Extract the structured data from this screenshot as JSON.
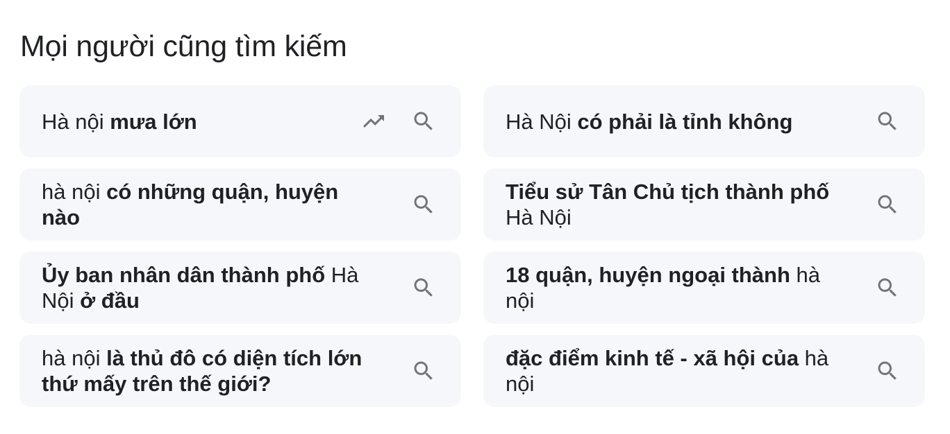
{
  "heading": "Mọi người cũng tìm kiếm",
  "items": [
    {
      "segments": [
        {
          "text": "Hà nội ",
          "bold": false
        },
        {
          "text": "mưa lớn",
          "bold": true
        }
      ],
      "icons": [
        "trending-icon",
        "search-icon"
      ]
    },
    {
      "segments": [
        {
          "text": "Hà Nội ",
          "bold": false
        },
        {
          "text": "có phải là tỉnh không",
          "bold": true
        }
      ],
      "icons": [
        "search-icon"
      ]
    },
    {
      "segments": [
        {
          "text": "hà nội ",
          "bold": false
        },
        {
          "text": "có những quận, huyện nào",
          "bold": true
        }
      ],
      "icons": [
        "search-icon"
      ]
    },
    {
      "segments": [
        {
          "text": "Tiểu sử Tân Chủ tịch thành phố",
          "bold": true
        },
        {
          "text": " Hà Nội",
          "bold": false
        }
      ],
      "icons": [
        "search-icon"
      ]
    },
    {
      "segments": [
        {
          "text": "Ủy ban nhân dân thành phố",
          "bold": true
        },
        {
          "text": " Hà Nội ",
          "bold": false
        },
        {
          "text": "ở đầu",
          "bold": true
        }
      ],
      "icons": [
        "search-icon"
      ]
    },
    {
      "segments": [
        {
          "text": "18 quận, huyện ngoại thành",
          "bold": true
        },
        {
          "text": " hà nội",
          "bold": false
        }
      ],
      "icons": [
        "search-icon"
      ]
    },
    {
      "segments": [
        {
          "text": "hà nội ",
          "bold": false
        },
        {
          "text": "là thủ đô có diện tích lớn thứ mấy trên thế giới?",
          "bold": true
        }
      ],
      "icons": [
        "search-icon"
      ]
    },
    {
      "segments": [
        {
          "text": "đặc điểm kinh tế - xã hội của",
          "bold": true
        },
        {
          "text": " hà nội",
          "bold": false
        }
      ],
      "icons": [
        "search-icon"
      ]
    }
  ],
  "colors": {
    "chip_background": "#f6f7fa",
    "text": "#202124",
    "icon": "#70757a"
  }
}
